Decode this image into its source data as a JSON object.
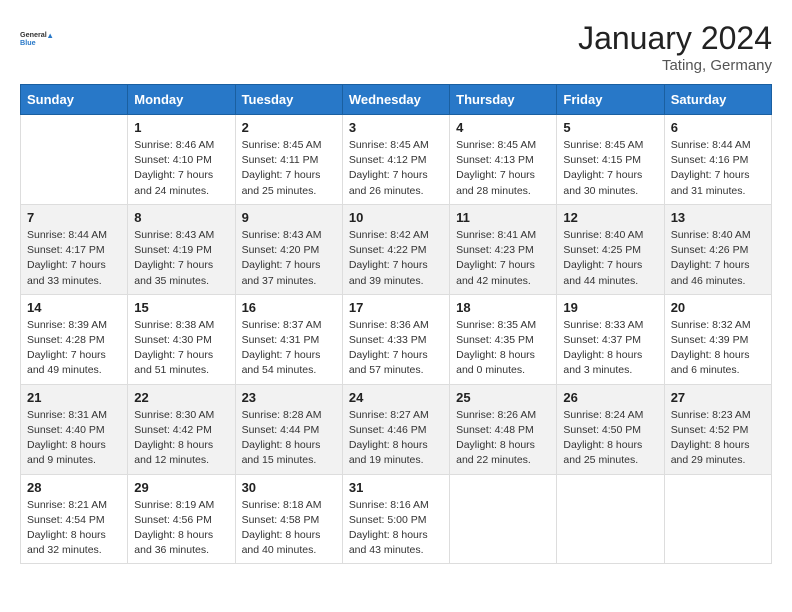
{
  "logo": {
    "line1": "General",
    "line2": "Blue"
  },
  "title": "January 2024",
  "location": "Tating, Germany",
  "days_of_week": [
    "Sunday",
    "Monday",
    "Tuesday",
    "Wednesday",
    "Thursday",
    "Friday",
    "Saturday"
  ],
  "weeks": [
    [
      {
        "day": "",
        "sunrise": "",
        "sunset": "",
        "daylight": ""
      },
      {
        "day": "1",
        "sunrise": "Sunrise: 8:46 AM",
        "sunset": "Sunset: 4:10 PM",
        "daylight": "Daylight: 7 hours and 24 minutes."
      },
      {
        "day": "2",
        "sunrise": "Sunrise: 8:45 AM",
        "sunset": "Sunset: 4:11 PM",
        "daylight": "Daylight: 7 hours and 25 minutes."
      },
      {
        "day": "3",
        "sunrise": "Sunrise: 8:45 AM",
        "sunset": "Sunset: 4:12 PM",
        "daylight": "Daylight: 7 hours and 26 minutes."
      },
      {
        "day": "4",
        "sunrise": "Sunrise: 8:45 AM",
        "sunset": "Sunset: 4:13 PM",
        "daylight": "Daylight: 7 hours and 28 minutes."
      },
      {
        "day": "5",
        "sunrise": "Sunrise: 8:45 AM",
        "sunset": "Sunset: 4:15 PM",
        "daylight": "Daylight: 7 hours and 30 minutes."
      },
      {
        "day": "6",
        "sunrise": "Sunrise: 8:44 AM",
        "sunset": "Sunset: 4:16 PM",
        "daylight": "Daylight: 7 hours and 31 minutes."
      }
    ],
    [
      {
        "day": "7",
        "sunrise": "Sunrise: 8:44 AM",
        "sunset": "Sunset: 4:17 PM",
        "daylight": "Daylight: 7 hours and 33 minutes."
      },
      {
        "day": "8",
        "sunrise": "Sunrise: 8:43 AM",
        "sunset": "Sunset: 4:19 PM",
        "daylight": "Daylight: 7 hours and 35 minutes."
      },
      {
        "day": "9",
        "sunrise": "Sunrise: 8:43 AM",
        "sunset": "Sunset: 4:20 PM",
        "daylight": "Daylight: 7 hours and 37 minutes."
      },
      {
        "day": "10",
        "sunrise": "Sunrise: 8:42 AM",
        "sunset": "Sunset: 4:22 PM",
        "daylight": "Daylight: 7 hours and 39 minutes."
      },
      {
        "day": "11",
        "sunrise": "Sunrise: 8:41 AM",
        "sunset": "Sunset: 4:23 PM",
        "daylight": "Daylight: 7 hours and 42 minutes."
      },
      {
        "day": "12",
        "sunrise": "Sunrise: 8:40 AM",
        "sunset": "Sunset: 4:25 PM",
        "daylight": "Daylight: 7 hours and 44 minutes."
      },
      {
        "day": "13",
        "sunrise": "Sunrise: 8:40 AM",
        "sunset": "Sunset: 4:26 PM",
        "daylight": "Daylight: 7 hours and 46 minutes."
      }
    ],
    [
      {
        "day": "14",
        "sunrise": "Sunrise: 8:39 AM",
        "sunset": "Sunset: 4:28 PM",
        "daylight": "Daylight: 7 hours and 49 minutes."
      },
      {
        "day": "15",
        "sunrise": "Sunrise: 8:38 AM",
        "sunset": "Sunset: 4:30 PM",
        "daylight": "Daylight: 7 hours and 51 minutes."
      },
      {
        "day": "16",
        "sunrise": "Sunrise: 8:37 AM",
        "sunset": "Sunset: 4:31 PM",
        "daylight": "Daylight: 7 hours and 54 minutes."
      },
      {
        "day": "17",
        "sunrise": "Sunrise: 8:36 AM",
        "sunset": "Sunset: 4:33 PM",
        "daylight": "Daylight: 7 hours and 57 minutes."
      },
      {
        "day": "18",
        "sunrise": "Sunrise: 8:35 AM",
        "sunset": "Sunset: 4:35 PM",
        "daylight": "Daylight: 8 hours and 0 minutes."
      },
      {
        "day": "19",
        "sunrise": "Sunrise: 8:33 AM",
        "sunset": "Sunset: 4:37 PM",
        "daylight": "Daylight: 8 hours and 3 minutes."
      },
      {
        "day": "20",
        "sunrise": "Sunrise: 8:32 AM",
        "sunset": "Sunset: 4:39 PM",
        "daylight": "Daylight: 8 hours and 6 minutes."
      }
    ],
    [
      {
        "day": "21",
        "sunrise": "Sunrise: 8:31 AM",
        "sunset": "Sunset: 4:40 PM",
        "daylight": "Daylight: 8 hours and 9 minutes."
      },
      {
        "day": "22",
        "sunrise": "Sunrise: 8:30 AM",
        "sunset": "Sunset: 4:42 PM",
        "daylight": "Daylight: 8 hours and 12 minutes."
      },
      {
        "day": "23",
        "sunrise": "Sunrise: 8:28 AM",
        "sunset": "Sunset: 4:44 PM",
        "daylight": "Daylight: 8 hours and 15 minutes."
      },
      {
        "day": "24",
        "sunrise": "Sunrise: 8:27 AM",
        "sunset": "Sunset: 4:46 PM",
        "daylight": "Daylight: 8 hours and 19 minutes."
      },
      {
        "day": "25",
        "sunrise": "Sunrise: 8:26 AM",
        "sunset": "Sunset: 4:48 PM",
        "daylight": "Daylight: 8 hours and 22 minutes."
      },
      {
        "day": "26",
        "sunrise": "Sunrise: 8:24 AM",
        "sunset": "Sunset: 4:50 PM",
        "daylight": "Daylight: 8 hours and 25 minutes."
      },
      {
        "day": "27",
        "sunrise": "Sunrise: 8:23 AM",
        "sunset": "Sunset: 4:52 PM",
        "daylight": "Daylight: 8 hours and 29 minutes."
      }
    ],
    [
      {
        "day": "28",
        "sunrise": "Sunrise: 8:21 AM",
        "sunset": "Sunset: 4:54 PM",
        "daylight": "Daylight: 8 hours and 32 minutes."
      },
      {
        "day": "29",
        "sunrise": "Sunrise: 8:19 AM",
        "sunset": "Sunset: 4:56 PM",
        "daylight": "Daylight: 8 hours and 36 minutes."
      },
      {
        "day": "30",
        "sunrise": "Sunrise: 8:18 AM",
        "sunset": "Sunset: 4:58 PM",
        "daylight": "Daylight: 8 hours and 40 minutes."
      },
      {
        "day": "31",
        "sunrise": "Sunrise: 8:16 AM",
        "sunset": "Sunset: 5:00 PM",
        "daylight": "Daylight: 8 hours and 43 minutes."
      },
      {
        "day": "",
        "sunrise": "",
        "sunset": "",
        "daylight": ""
      },
      {
        "day": "",
        "sunrise": "",
        "sunset": "",
        "daylight": ""
      },
      {
        "day": "",
        "sunrise": "",
        "sunset": "",
        "daylight": ""
      }
    ]
  ]
}
